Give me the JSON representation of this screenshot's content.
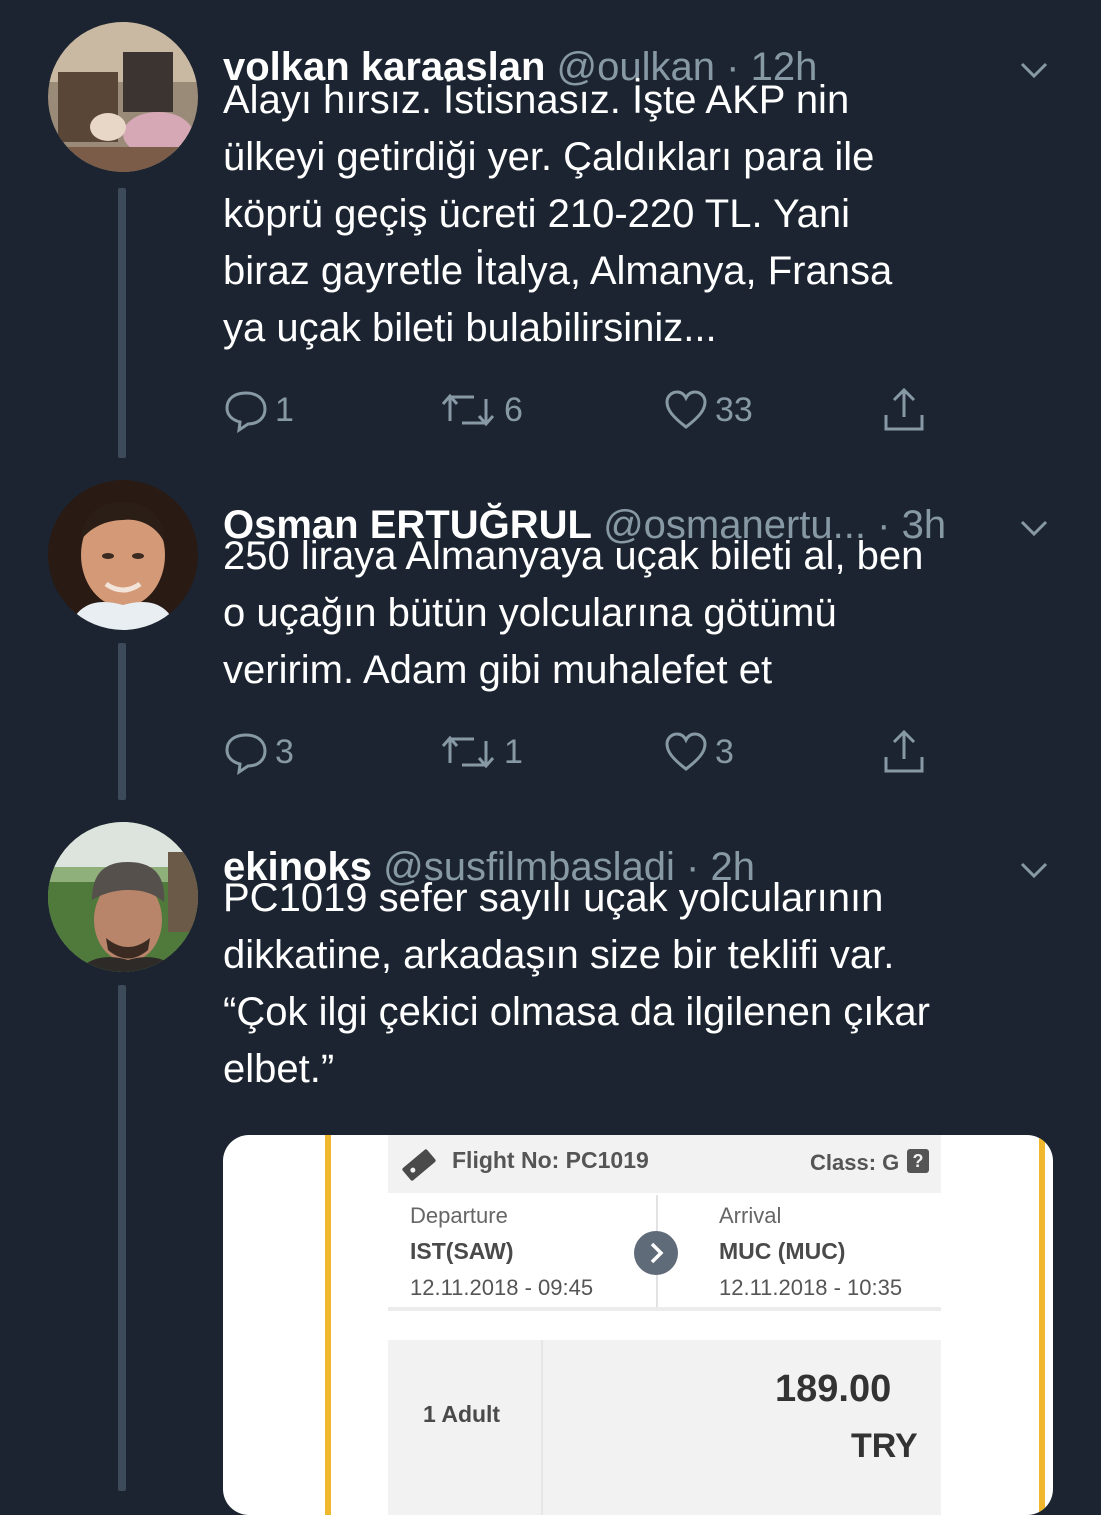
{
  "tweets": [
    {
      "name": "volkan karaaslan",
      "handle": "@oulkan",
      "dot": "·",
      "time": "12h",
      "text_lines": [
        "Alayı hırsız. İstisnasız. İşte AKP nin",
        "ülkeyi getirdiği yer. Çaldıkları para ile",
        "köprü geçiş ücreti 210-220 TL. Yani",
        "biraz gayretle  İtalya, Almanya, Fransa",
        "ya uçak bileti bulabilirsiniz..."
      ],
      "replies": "1",
      "retweets": "6",
      "likes": "33"
    },
    {
      "name": "Osman ERTUĞRUL",
      "handle": "@osmanertu...",
      "dot": "·",
      "time": "3h",
      "text_lines": [
        "250 liraya Almanyaya uçak bileti al, ben",
        "o uçağın bütün yolcularına götümü",
        "veririm. Adam gibi muhalefet et"
      ],
      "replies": "3",
      "retweets": "1",
      "likes": "3"
    },
    {
      "name": "ekinoks",
      "handle": "@susfilmbasladi",
      "dot": "·",
      "time": "2h",
      "text_lines": [
        "PC1019 sefer sayılı uçak yolcularının",
        "dikkatine, arkadaşın size bir teklifi var.",
        "“Çok ilgi çekici olmasa da ilgilenen çıkar",
        "elbet.”"
      ]
    }
  ],
  "flight_card": {
    "flight_no": "Flight No: PC1019",
    "class": "Class: G",
    "class_icon": "?",
    "departure_label": "Departure",
    "departure_code": "IST(SAW)",
    "departure_time": "12.11.2018 - 09:45",
    "arrival_label": "Arrival",
    "arrival_code": "MUC (MUC)",
    "arrival_time": "12.11.2018 - 10:35",
    "passengers": "1 Adult",
    "price": "189.00",
    "currency": "TRY"
  },
  "colors": {
    "background": "#1b2430",
    "secondary_text": "#8899a6",
    "thread_line": "#3d4a5a",
    "card_accent": "#f1b82d"
  },
  "icons": [
    "reply-icon",
    "retweet-icon",
    "like-icon",
    "share-icon",
    "chevron-down-icon",
    "ticket-icon",
    "arrow-right-icon"
  ]
}
